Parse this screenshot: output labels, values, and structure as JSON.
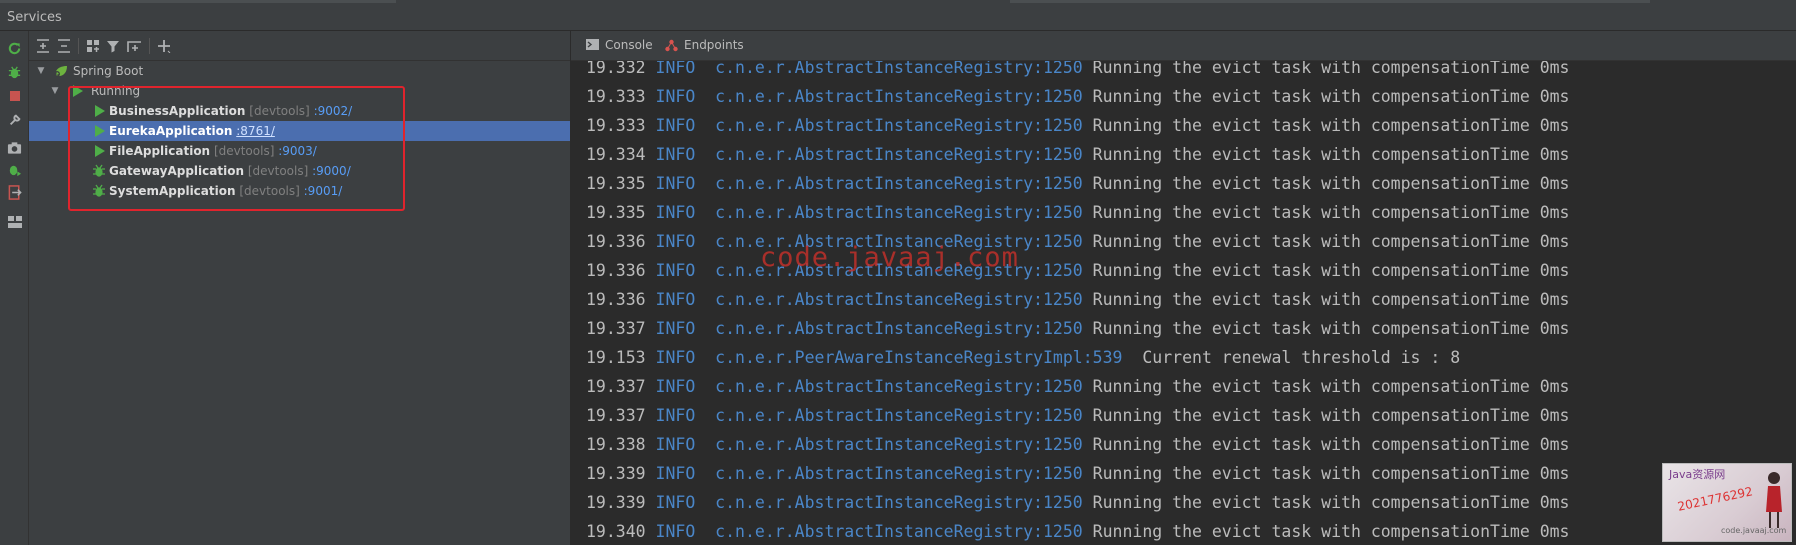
{
  "window": {
    "title": "Services"
  },
  "left_toolbar": {
    "icons": [
      "refresh-icon",
      "bug-icon",
      "stop-icon",
      "wrench-icon",
      "camera-icon",
      "debug-run-icon",
      "exit-icon",
      "layout-icon"
    ]
  },
  "tree_toolbar": {
    "icons": [
      "expand-all-icon",
      "collapse-all-icon",
      "group-icon",
      "filter-icon",
      "new-tab-icon",
      "add-icon"
    ]
  },
  "tree": {
    "root_label": "Spring Boot",
    "group_label": "Running",
    "apps": [
      {
        "name": "BusinessApplication",
        "tag": "[devtools]",
        "port": ":9002/",
        "status": "run",
        "selected": false
      },
      {
        "name": "EurekaApplication",
        "tag": "",
        "port": ":8761/",
        "status": "run",
        "selected": true
      },
      {
        "name": "FileApplication",
        "tag": "[devtools]",
        "port": ":9003/",
        "status": "run",
        "selected": false
      },
      {
        "name": "GatewayApplication",
        "tag": "[devtools]",
        "port": ":9000/",
        "status": "debug",
        "selected": false
      },
      {
        "name": "SystemApplication",
        "tag": "[devtools]",
        "port": ":9001/",
        "status": "debug",
        "selected": false
      }
    ]
  },
  "tabs": [
    {
      "label": "Console",
      "icon": "console-icon"
    },
    {
      "label": "Endpoints",
      "icon": "endpoints-icon"
    }
  ],
  "console": {
    "lines": [
      {
        "time": "19.332",
        "level": "INFO",
        "source": "c.n.e.r.AbstractInstanceRegistry:1250",
        "message": "Running the evict task with compensationTime 0ms"
      },
      {
        "time": "19.333",
        "level": "INFO",
        "source": "c.n.e.r.AbstractInstanceRegistry:1250",
        "message": "Running the evict task with compensationTime 0ms"
      },
      {
        "time": "19.333",
        "level": "INFO",
        "source": "c.n.e.r.AbstractInstanceRegistry:1250",
        "message": "Running the evict task with compensationTime 0ms"
      },
      {
        "time": "19.334",
        "level": "INFO",
        "source": "c.n.e.r.AbstractInstanceRegistry:1250",
        "message": "Running the evict task with compensationTime 0ms"
      },
      {
        "time": "19.335",
        "level": "INFO",
        "source": "c.n.e.r.AbstractInstanceRegistry:1250",
        "message": "Running the evict task with compensationTime 0ms"
      },
      {
        "time": "19.335",
        "level": "INFO",
        "source": "c.n.e.r.AbstractInstanceRegistry:1250",
        "message": "Running the evict task with compensationTime 0ms"
      },
      {
        "time": "19.336",
        "level": "INFO",
        "source": "c.n.e.r.AbstractInstanceRegistry:1250",
        "message": "Running the evict task with compensationTime 0ms"
      },
      {
        "time": "19.336",
        "level": "INFO",
        "source": "c.n.e.r.AbstractInstanceRegistry:1250",
        "message": "Running the evict task with compensationTime 0ms"
      },
      {
        "time": "19.336",
        "level": "INFO",
        "source": "c.n.e.r.AbstractInstanceRegistry:1250",
        "message": "Running the evict task with compensationTime 0ms"
      },
      {
        "time": "19.337",
        "level": "INFO",
        "source": "c.n.e.r.AbstractInstanceRegistry:1250",
        "message": "Running the evict task with compensationTime 0ms"
      },
      {
        "time": "19.153",
        "level": "INFO",
        "source": "c.n.e.r.PeerAwareInstanceRegistryImpl:539",
        "message": " Current renewal threshold is : 8"
      },
      {
        "time": "19.337",
        "level": "INFO",
        "source": "c.n.e.r.AbstractInstanceRegistry:1250",
        "message": "Running the evict task with compensationTime 0ms"
      },
      {
        "time": "19.337",
        "level": "INFO",
        "source": "c.n.e.r.AbstractInstanceRegistry:1250",
        "message": "Running the evict task with compensationTime 0ms"
      },
      {
        "time": "19.338",
        "level": "INFO",
        "source": "c.n.e.r.AbstractInstanceRegistry:1250",
        "message": "Running the evict task with compensationTime 0ms"
      },
      {
        "time": "19.339",
        "level": "INFO",
        "source": "c.n.e.r.AbstractInstanceRegistry:1250",
        "message": "Running the evict task with compensationTime 0ms"
      },
      {
        "time": "19.339",
        "level": "INFO",
        "source": "c.n.e.r.AbstractInstanceRegistry:1250",
        "message": "Running the evict task with compensationTime 0ms"
      },
      {
        "time": "19.340",
        "level": "INFO",
        "source": "c.n.e.r.AbstractInstanceRegistry:1250",
        "message": "Running the evict task with compensationTime 0ms"
      }
    ]
  },
  "overlays": {
    "watermark": "code.javaaj.com",
    "stamp_title": "Java资源网",
    "stamp_number": "2021776292",
    "stamp_site": "code.javaaj.com"
  },
  "colors": {
    "highlight_box": "#e0242d",
    "selection": "#4b6eaf",
    "run_green": "#4fae48",
    "info_blue": "#4a86c8"
  }
}
